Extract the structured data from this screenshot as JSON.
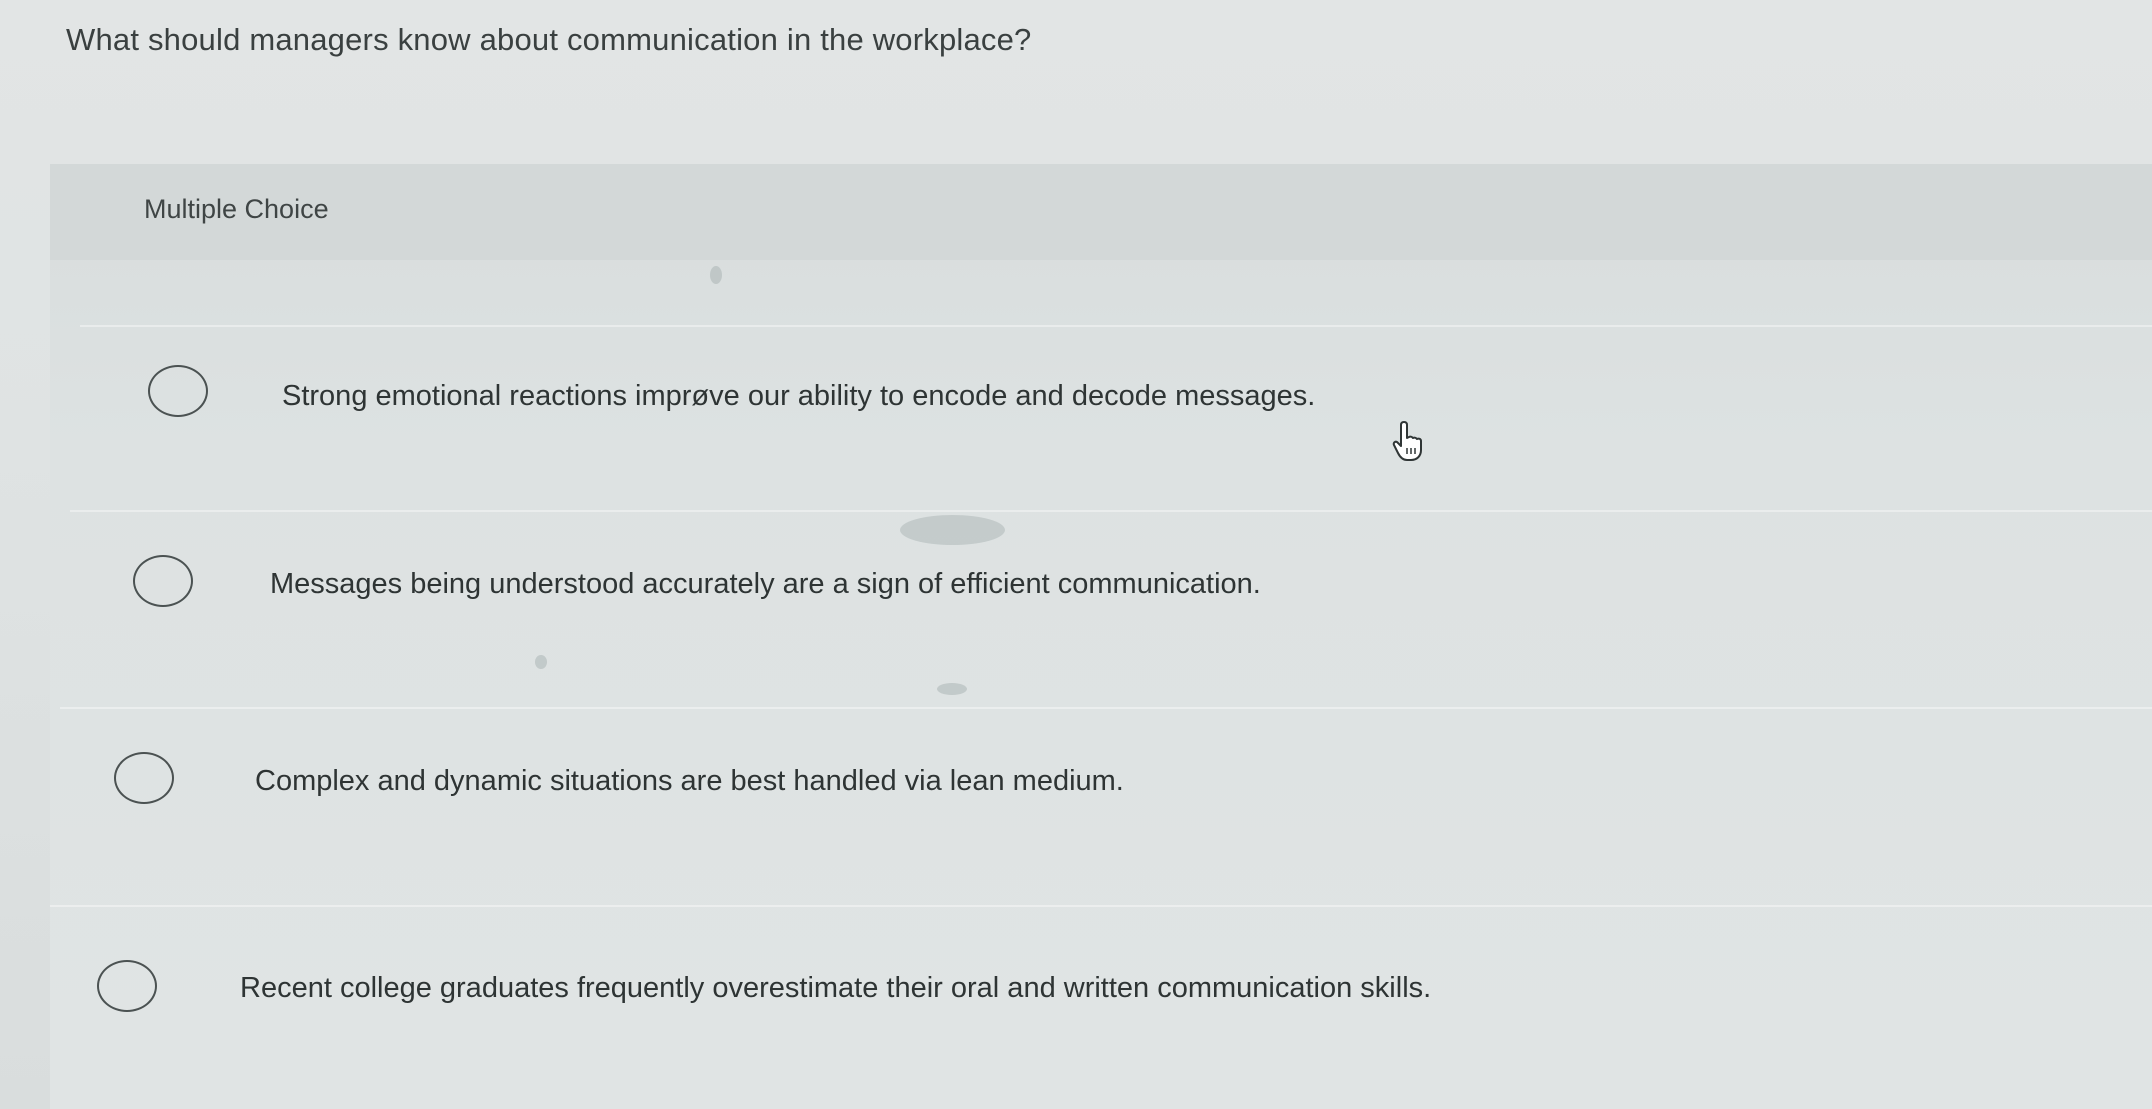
{
  "question": {
    "text": "What should managers know about communication in the workplace?"
  },
  "panel": {
    "type_label": "Multiple Choice"
  },
  "options": [
    {
      "label": "Strong emotional reactions imprøve our ability to encode and decode messages."
    },
    {
      "label": "Messages being understood accurately are a sign of efficient communication."
    },
    {
      "label": "Complex and dynamic situations are best handled via lean medium."
    },
    {
      "label": "Recent college graduates frequently overestimate their oral and written communication skills."
    }
  ],
  "icons": {
    "cursor": "hand-pointer-icon",
    "radio": "radio-unchecked-icon"
  }
}
